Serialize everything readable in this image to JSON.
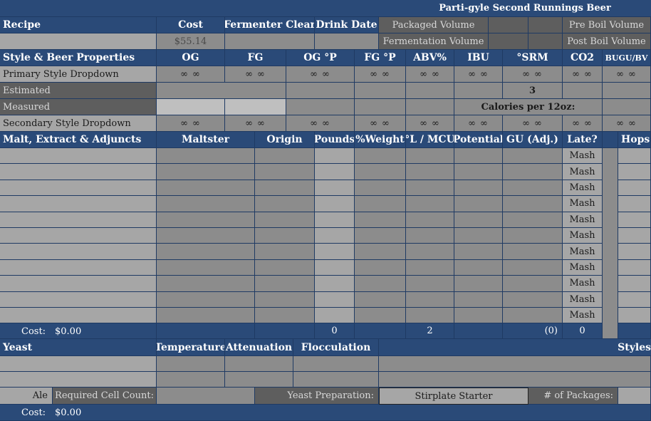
{
  "title": "Parti-gyle Second Runnings Beer",
  "recipe": {
    "label": "Recipe",
    "cost_label": "Cost",
    "cost_value": "$55.14",
    "fermenter_clear_label": "Fermenter Clear",
    "drink_date_label": "Drink Date",
    "packaged_volume_label": "Packaged Volume",
    "fermentation_volume_label": "Fermentation Volume",
    "pre_boil_label": "Pre Boil Volume",
    "post_boil_label": "Post Boil Volume"
  },
  "style": {
    "header": "Style & Beer Properties",
    "columns": [
      "OG",
      "FG",
      "OG °P",
      "FG °P",
      "ABV%",
      "IBU",
      "°SRM",
      "CO2",
      "BUGU/BV"
    ],
    "inf": "∞  ∞",
    "rows": {
      "primary": "Primary Style Dropdown",
      "estimated": "Estimated",
      "measured": "Measured",
      "secondary": "Secondary Style Dropdown"
    },
    "estimated_srm": "3",
    "calories_label": "Calories per 12oz:"
  },
  "malt": {
    "header": "Malt, Extract & Adjuncts",
    "columns": [
      "Maltster",
      "Origin",
      "Pounds",
      "%Weight",
      "°L / MCU",
      "Potential",
      "GU (Adj.)",
      "Late?"
    ],
    "late_value": "Mash",
    "hops_label": "Hops",
    "cost_label": "Cost:",
    "cost_value": "$0.00",
    "total_pounds": "0",
    "total_mcu": "2",
    "total_gu": "(0)",
    "total_late": "0"
  },
  "yeast": {
    "header": "Yeast",
    "columns": [
      "Temperature",
      "Attenuation",
      "Flocculation"
    ],
    "styles_label": "Styles",
    "type_value": "Ale",
    "cell_count_label": "Required Cell Count:",
    "prep_label": "Yeast Preparation:",
    "prep_value": "Stirplate Starter",
    "packages_label": "# of Packages:",
    "cost_label": "Cost:",
    "cost_value": "$0.00"
  }
}
